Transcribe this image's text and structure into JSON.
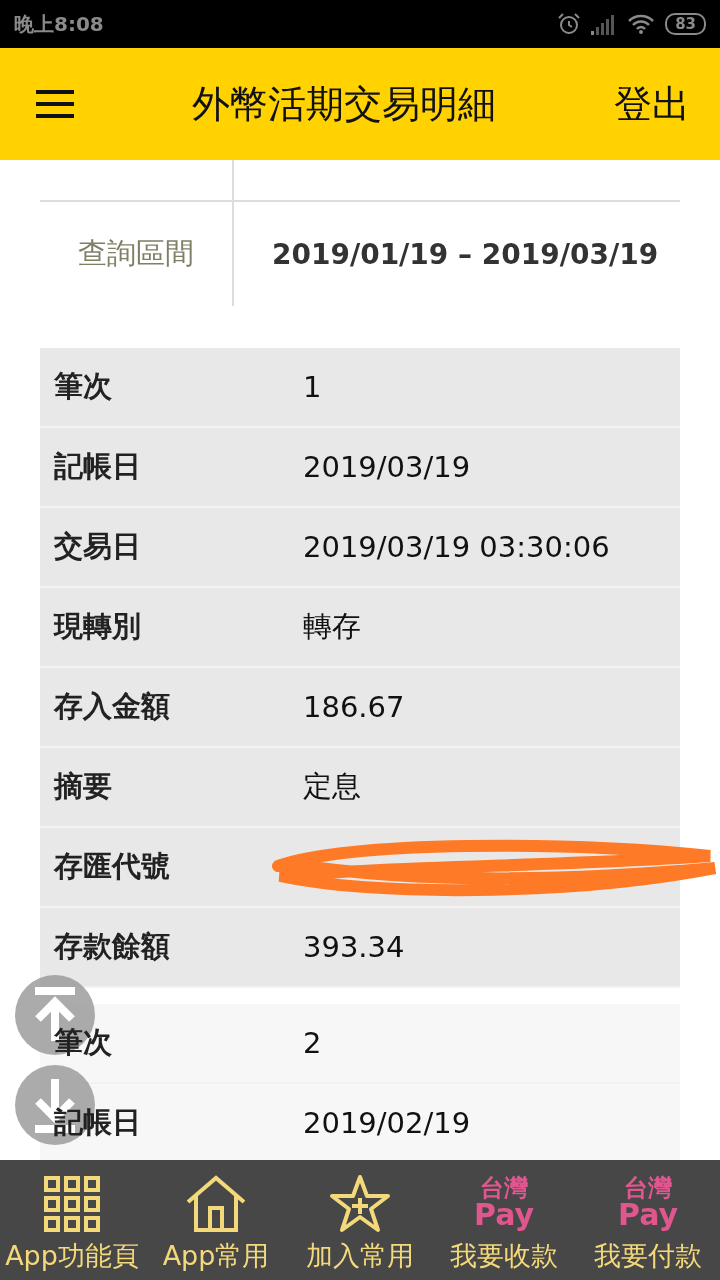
{
  "status_bar": {
    "time": "晚上8:08",
    "battery": "83"
  },
  "header": {
    "title": "外幣活期交易明細",
    "logout": "登出"
  },
  "query": {
    "label": "查詢區間",
    "value": "2019/01/19 – 2019/03/19"
  },
  "transactions": [
    {
      "selected": true,
      "rows": [
        {
          "label": "筆次",
          "value": "1"
        },
        {
          "label": "記帳日",
          "value": "2019/03/19"
        },
        {
          "label": "交易日",
          "value": "2019/03/19 03:30:06"
        },
        {
          "label": "現轉別",
          "value": "轉存"
        },
        {
          "label": "存入金額",
          "value": "186.67"
        },
        {
          "label": "摘要",
          "value": "定息"
        },
        {
          "label": "存匯代號",
          "redacted": true
        },
        {
          "label": "存款餘額",
          "value": "393.34"
        }
      ]
    },
    {
      "selected": false,
      "rows": [
        {
          "label": "筆次",
          "value": "2"
        },
        {
          "label": "記帳日",
          "value": "2019/02/19"
        }
      ]
    }
  ],
  "bottom_nav": [
    {
      "kind": "grid",
      "label": "App功能頁"
    },
    {
      "kind": "home",
      "label": "App常用"
    },
    {
      "kind": "star",
      "label": "加入常用"
    },
    {
      "kind": "pay",
      "label": "我要收款",
      "logo": [
        "台灣",
        "Pay"
      ]
    },
    {
      "kind": "pay",
      "label": "我要付款",
      "logo": [
        "台灣",
        "Pay"
      ]
    }
  ]
}
